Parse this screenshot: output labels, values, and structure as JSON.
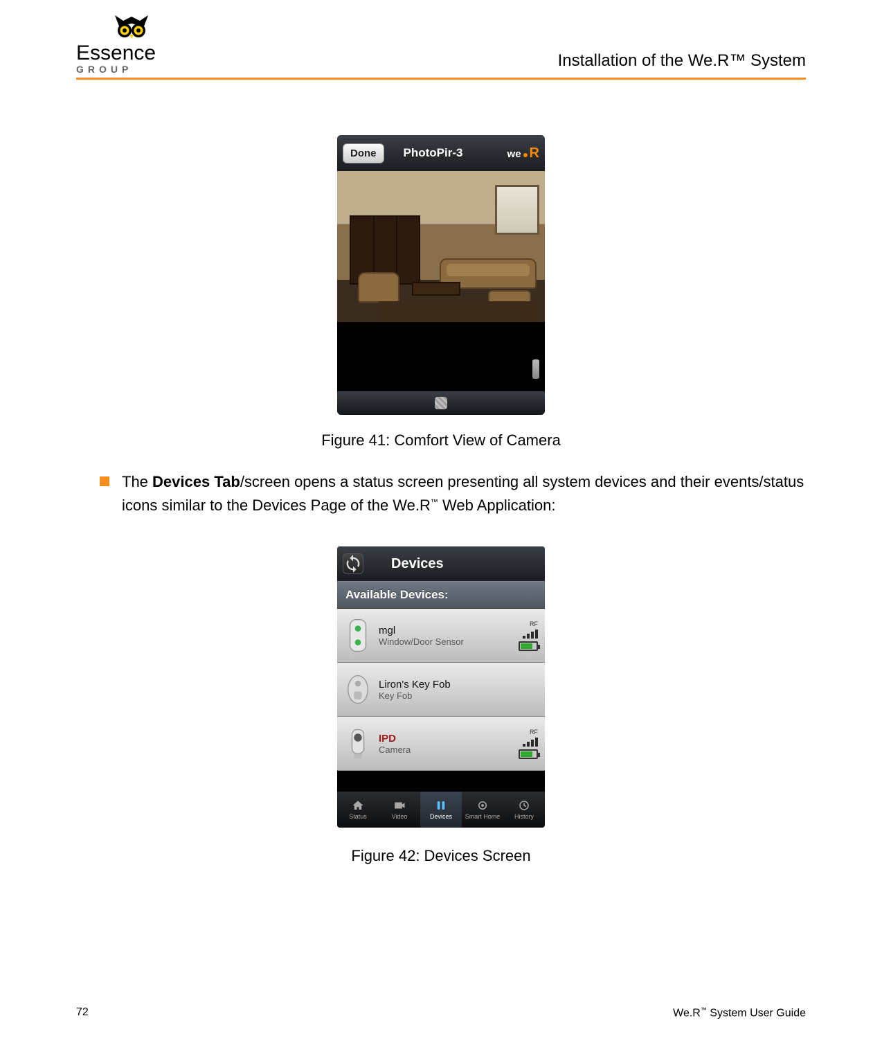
{
  "header": {
    "logo": {
      "name": "Essence",
      "sub": "GROUP"
    },
    "title": "Installation of the We.R™ System"
  },
  "figure41": {
    "caption": "Figure 41: Comfort View of Camera",
    "topbar": {
      "done": "Done",
      "title": "PhotoPir-3",
      "brand_we": "we",
      "brand_r": "R"
    }
  },
  "bullet": {
    "text_prefix": "The ",
    "bold": "Devices Tab",
    "text_mid": "/screen opens a status screen presenting all system devices and their events/status icons similar to the Devices Page of the We.R",
    "tm": "™",
    "text_suffix": " Web Application:"
  },
  "figure42": {
    "caption": "Figure 42: Devices Screen",
    "topbar": {
      "title": "Devices"
    },
    "section": "Available Devices:",
    "rows": [
      {
        "name": "mgl",
        "type": "Window/Door Sensor",
        "rf": "RF",
        "alert": false
      },
      {
        "name": "Liron's Key Fob",
        "type": "Key Fob",
        "rf": "",
        "alert": false
      },
      {
        "name": "IPD",
        "type": "Camera",
        "rf": "RF",
        "alert": true
      }
    ],
    "tabs": [
      {
        "label": "Status"
      },
      {
        "label": "Video"
      },
      {
        "label": "Devices"
      },
      {
        "label": "Smart Home"
      },
      {
        "label": "History"
      }
    ],
    "active_tab": 2
  },
  "footer": {
    "page": "72",
    "guide_pre": "We.R",
    "guide_tm": "™",
    "guide_post": " System User Guide"
  }
}
